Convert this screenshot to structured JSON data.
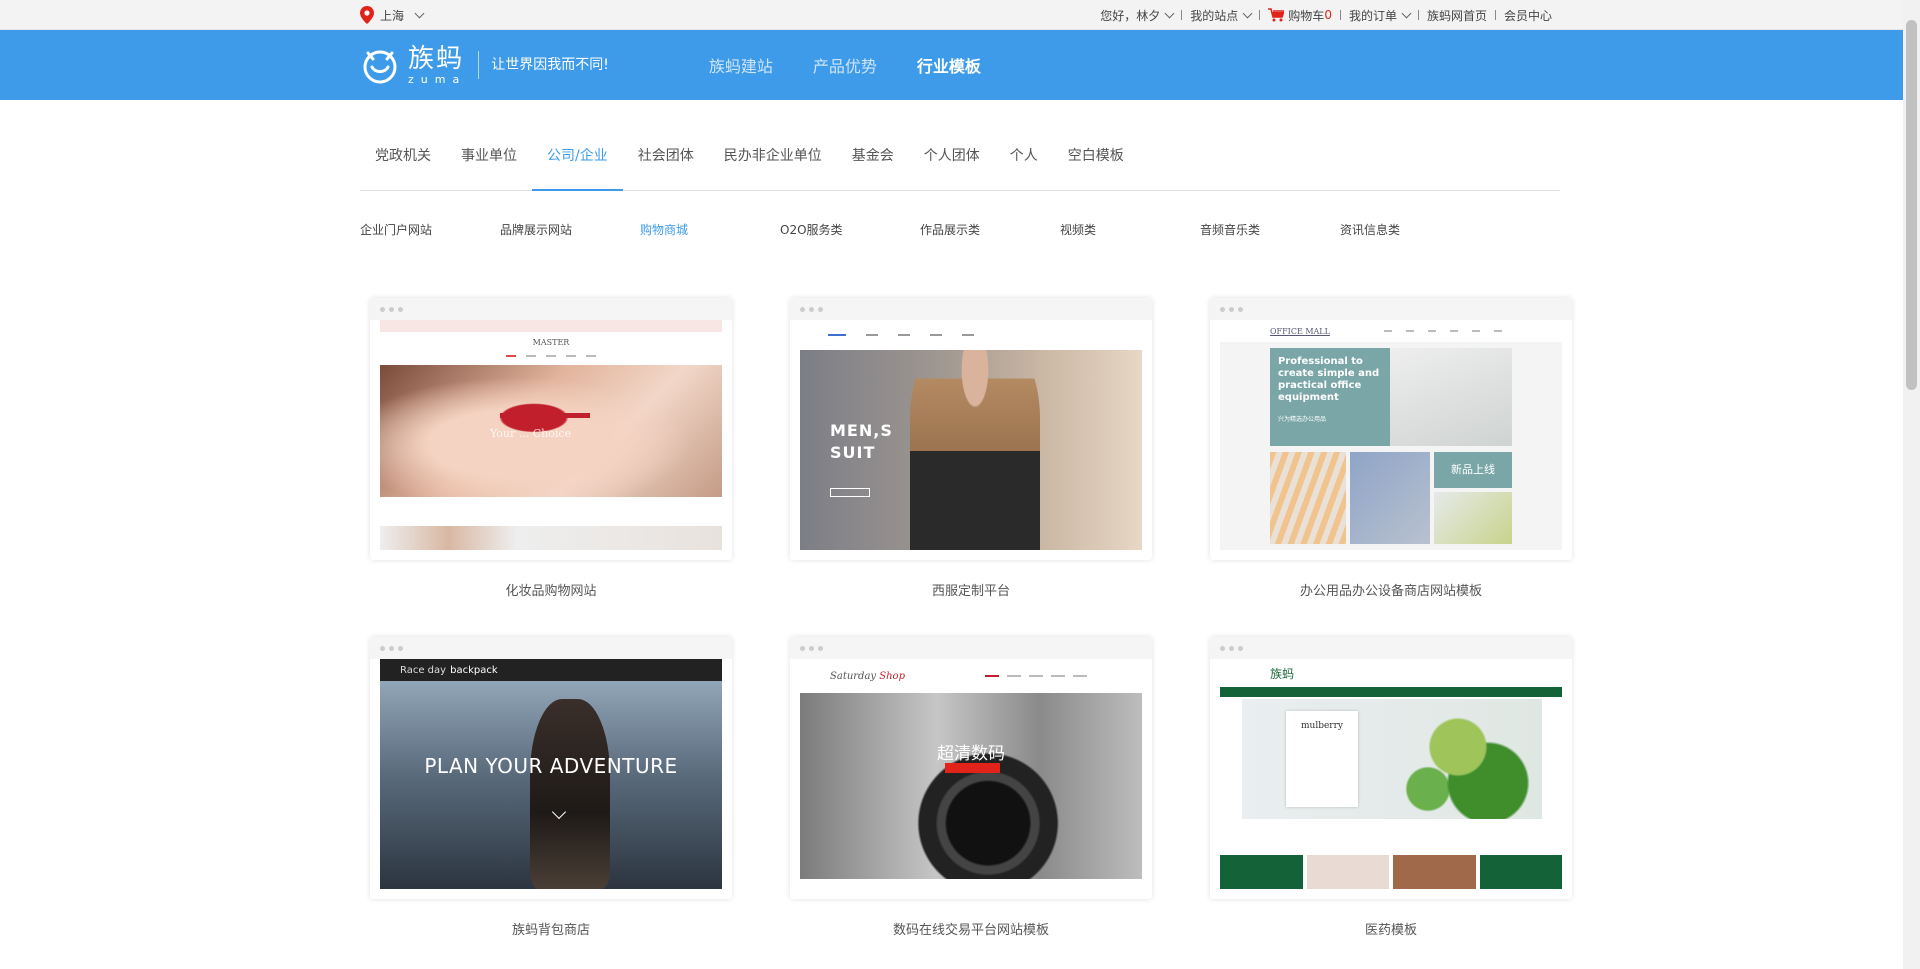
{
  "topbar": {
    "location": "上海",
    "greeting": "您好，林夕",
    "my_sites": "我的站点",
    "cart_label": "购物车",
    "cart_count": "0",
    "my_orders": "我的订单",
    "home": "族蚂网首页",
    "member": "会员中心"
  },
  "header": {
    "logo_cn": "族蚂",
    "logo_en": "zuma",
    "slogan": "让世界因我而不同!",
    "nav": [
      "族蚂建站",
      "产品优势",
      "行业模板"
    ]
  },
  "categories": [
    "党政机关",
    "事业单位",
    "公司/企业",
    "社会团体",
    "民办非企业单位",
    "基金会",
    "个人团体",
    "个人",
    "空白模板"
  ],
  "subcategories": [
    "企业门户网站",
    "品牌展示网站",
    "购物商城",
    "O2O服务类",
    "作品展示类",
    "视频类",
    "音频音乐类",
    "资讯信息类"
  ],
  "templates": [
    {
      "caption": "化妆品购物网站",
      "brand": "MASTER",
      "script": "Your ... Choice"
    },
    {
      "caption": "西服定制平台",
      "title1": "MEN,S",
      "title2": "SUIT"
    },
    {
      "caption": "办公用品办公设备商店网站模板",
      "brand": "OFFICE MALL",
      "panel": "Professional to create simple and practical office equipment",
      "panel_sub": "兴为精选办公用品",
      "badge": "新品上线"
    },
    {
      "caption": "族蚂背包商店",
      "nav_a": "Race day",
      "nav_b": "backpack",
      "hero": "PLAN YOUR ADVENTURE"
    },
    {
      "caption": "数码在线交易平台网站模板",
      "brand_a": "Saturday",
      "brand_b": "Shop",
      "hero": "超清数码"
    },
    {
      "caption": "医药模板",
      "brand": "族蚂",
      "card_title": "mulberry"
    }
  ]
}
